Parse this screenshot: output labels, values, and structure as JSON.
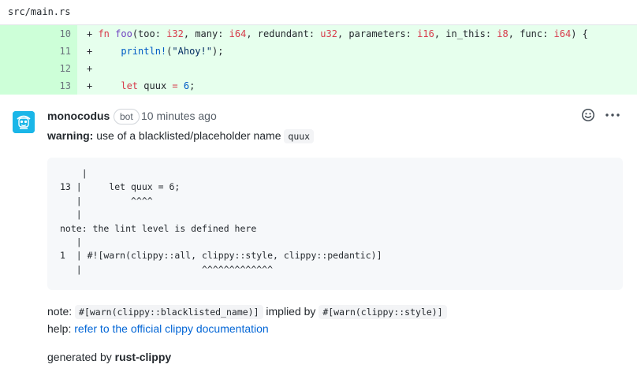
{
  "file": {
    "path": "src/main.rs"
  },
  "diff": {
    "rows": [
      {
        "line_no": "10",
        "tokens": [
          {
            "t": "+ ",
            "c": "plain"
          },
          {
            "t": "fn",
            "c": "kw"
          },
          {
            "t": " ",
            "c": "plain"
          },
          {
            "t": "foo",
            "c": "fn"
          },
          {
            "t": "(too: ",
            "c": "plain"
          },
          {
            "t": "i32",
            "c": "ty"
          },
          {
            "t": ", many: ",
            "c": "plain"
          },
          {
            "t": "i64",
            "c": "ty"
          },
          {
            "t": ", redundant: ",
            "c": "plain"
          },
          {
            "t": "u32",
            "c": "ty"
          },
          {
            "t": ", parameters: ",
            "c": "plain"
          },
          {
            "t": "i16",
            "c": "ty"
          },
          {
            "t": ", in_this: ",
            "c": "plain"
          },
          {
            "t": "i8",
            "c": "ty"
          },
          {
            "t": ", func: ",
            "c": "plain"
          },
          {
            "t": "i64",
            "c": "ty"
          },
          {
            "t": ") {",
            "c": "plain"
          }
        ]
      },
      {
        "line_no": "11",
        "tokens": [
          {
            "t": "+     ",
            "c": "plain"
          },
          {
            "t": "println!",
            "c": "mac"
          },
          {
            "t": "(",
            "c": "plain"
          },
          {
            "t": "\"Ahoy!\"",
            "c": "str"
          },
          {
            "t": ");",
            "c": "plain"
          }
        ]
      },
      {
        "line_no": "12",
        "tokens": [
          {
            "t": "+",
            "c": "plain"
          }
        ]
      },
      {
        "line_no": "13",
        "tokens": [
          {
            "t": "+     ",
            "c": "plain"
          },
          {
            "t": "let",
            "c": "kw"
          },
          {
            "t": " quux ",
            "c": "plain"
          },
          {
            "t": "=",
            "c": "kw"
          },
          {
            "t": " ",
            "c": "plain"
          },
          {
            "t": "6",
            "c": "num"
          },
          {
            "t": ";",
            "c": "plain"
          }
        ]
      }
    ]
  },
  "comment": {
    "author": "monocodus",
    "badge": "bot",
    "timestamp": "10 minutes ago",
    "warning_label": "warning:",
    "warning_text": " use of a blacklisted/placeholder name ",
    "warning_code": "quux",
    "code_block": "    |\n13 |     let quux = 6;\n   |         ^^^^\n   |\nnote: the lint level is defined here\n   |\n1  | #![warn(clippy::all, clippy::style, clippy::pedantic)]\n   |                      ^^^^^^^^^^^^^",
    "note_label": "note: ",
    "note_code_1": "#[warn(clippy::blacklisted_name)]",
    "note_middle": " implied by ",
    "note_code_2": "#[warn(clippy::style)]",
    "help_label": "help: ",
    "help_link": "refer to the official clippy documentation",
    "generated_prefix": "generated by ",
    "generated_tool": "rust-clippy",
    "icons": {
      "reaction": "smiley-icon",
      "more": "kebab-horizontal-icon",
      "avatar": "monocodus-logo"
    }
  },
  "colors": {
    "added_gutter": "#cdffd8",
    "added_code": "#e6ffed",
    "link": "#0366d6",
    "avatar_bg": "#1ab6e8"
  }
}
